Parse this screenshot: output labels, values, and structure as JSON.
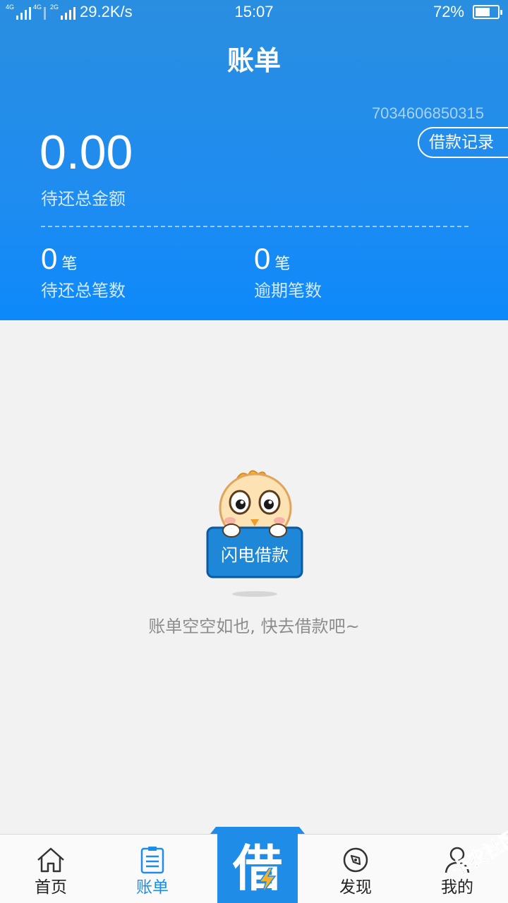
{
  "status_bar": {
    "network_left": "4G",
    "network_left2": "4G",
    "network_right": "2G",
    "net_speed": "29.2K/s",
    "time": "15:07",
    "battery_percent": "72%",
    "battery_level": 0.72
  },
  "header": {
    "title": "账单",
    "account_id": "7034606850315",
    "loan_record_button": "借款记录",
    "total_amount": "0.00",
    "total_amount_label": "待还总金额",
    "stats": [
      {
        "value": "0",
        "unit": "笔",
        "label": "待还总笔数"
      },
      {
        "value": "0",
        "unit": "笔",
        "label": "逾期笔数"
      }
    ]
  },
  "empty_state": {
    "sign_text": "闪电借款",
    "message": "账单空空如也, 快去借款吧~"
  },
  "tabbar": {
    "tabs": [
      {
        "label": "首页",
        "icon": "home-icon"
      },
      {
        "label": "账单",
        "icon": "bill-icon"
      },
      {
        "label": "借",
        "icon": "loan-icon"
      },
      {
        "label": "发现",
        "icon": "compass-icon"
      },
      {
        "label": "我的",
        "icon": "user-icon"
      }
    ],
    "active_index": 1
  },
  "watermark": {
    "text": "卡农社区"
  },
  "colors": {
    "primary": "#1f8ce8",
    "header_gradient_top": "#2a8ee0",
    "header_gradient_bottom": "#0d89fb",
    "background": "#f2f2f2",
    "muted_text": "#8c8c8c"
  }
}
